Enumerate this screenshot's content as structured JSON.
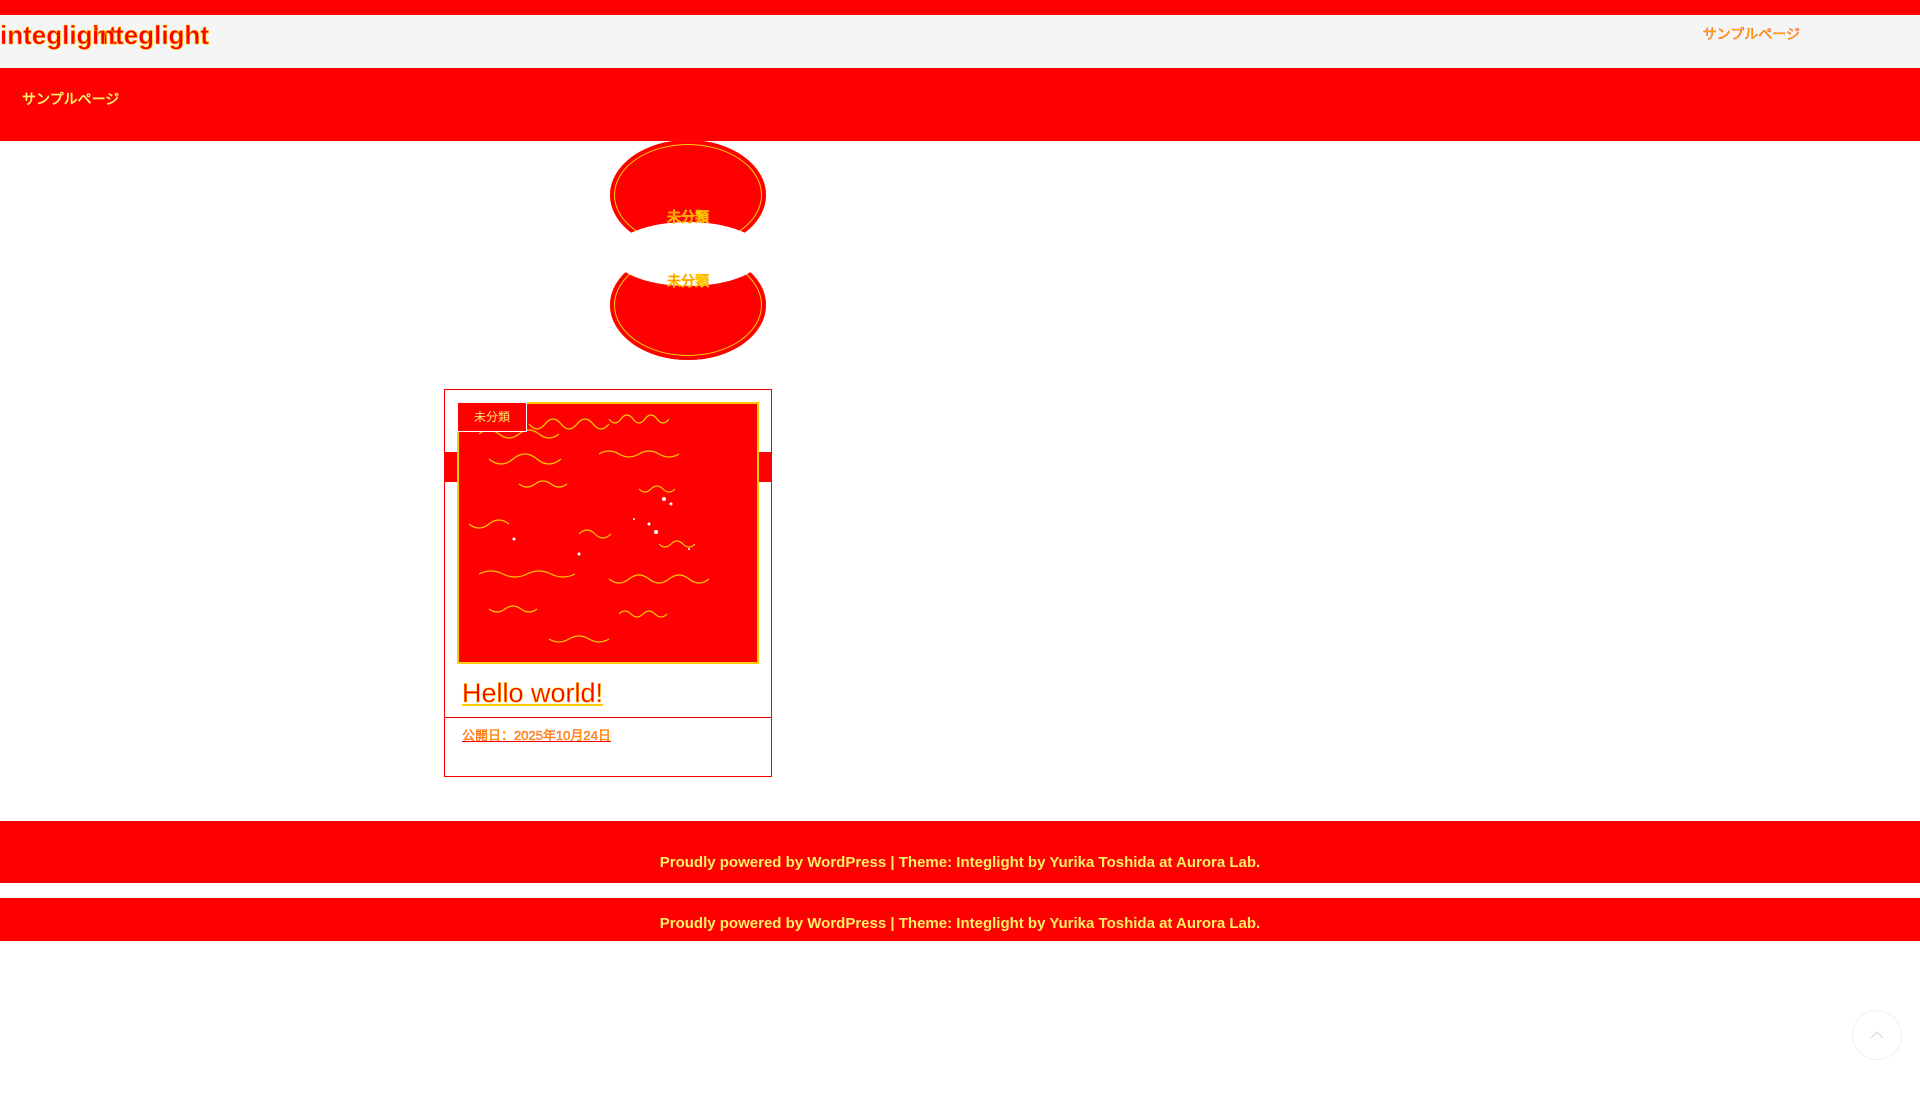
{
  "site": {
    "title": "integlight"
  },
  "header": {
    "nav_link": "サンプルページ"
  },
  "navbar": {
    "nav_link": "サンプルページ"
  },
  "categories": [
    "未分類",
    "未分類"
  ],
  "post": {
    "category_badge": "未分類",
    "title": "Hello world!",
    "date": "公開日：2025年10月24日"
  },
  "footer": {
    "lines": [
      {
        "powered": "Proudly powered by WordPress",
        "separator": " | ",
        "theme": "Theme: Integlight by Yurika Toshida at Aurora Lab."
      },
      {
        "powered": "Proudly powered by WordPress",
        "separator": " | ",
        "theme": "Theme: Integlight by Yurika Toshida at Aurora Lab."
      }
    ]
  },
  "icons": {
    "back_to_top": "chevron-up-icon"
  },
  "colors": {
    "accent": "#ff0000",
    "highlight": "#ffcc00",
    "header_bg": "#f5f5f5"
  }
}
